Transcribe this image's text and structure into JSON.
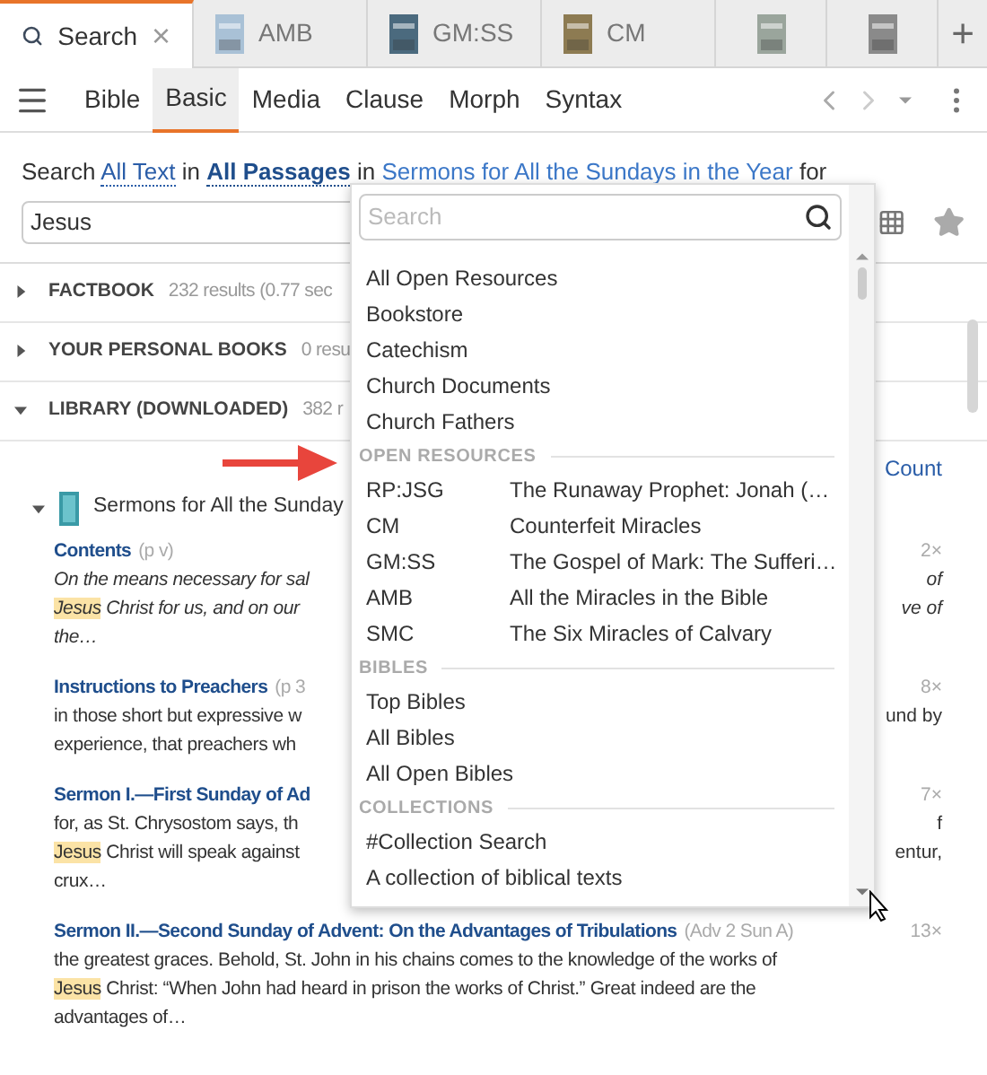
{
  "tabs": [
    {
      "kind": "search",
      "label": "Search",
      "selected": true,
      "close": "×"
    },
    {
      "kind": "book",
      "label": "AMB",
      "selected": false
    },
    {
      "kind": "book",
      "label": "GM:SS",
      "selected": false
    },
    {
      "kind": "book",
      "label": "CM",
      "selected": false
    },
    {
      "kind": "book",
      "selected": false
    },
    {
      "kind": "book",
      "selected": false
    }
  ],
  "new_tab": "+",
  "search_types": [
    {
      "label": "Bible",
      "selected": false
    },
    {
      "label": "Basic",
      "selected": true
    },
    {
      "label": "Media",
      "selected": false
    },
    {
      "label": "Clause",
      "selected": false
    },
    {
      "label": "Morph",
      "selected": false
    },
    {
      "label": "Syntax",
      "selected": false
    }
  ],
  "query_sentence": [
    {
      "kind": "plain",
      "text": "Search"
    },
    {
      "kind": "link",
      "text": "All Text"
    },
    {
      "kind": "plain",
      "text": "in"
    },
    {
      "kind": "strong_link",
      "text": "All Passages"
    },
    {
      "kind": "plain",
      "text": "in"
    },
    {
      "kind": "link",
      "text": "Sermons for All the Sundays in the Year"
    },
    {
      "kind": "plain",
      "text": "for"
    }
  ],
  "query": {
    "value": "Jesus"
  },
  "sections": [
    {
      "title": "FACTBOOK",
      "summary": "232 results (0.77 sec",
      "expanded": false
    },
    {
      "title": "YOUR PERSONAL BOOKS",
      "summary": "0 resu",
      "expanded": false
    },
    {
      "title": "LIBRARY (DOWNLOADED)",
      "summary": "382 r",
      "expanded": true
    }
  ],
  "count_link": "Count",
  "resource": {
    "title": "Sermons for All the Sunday",
    "expanded": true
  },
  "results": [
    {
      "title": "Contents",
      "ref": "(p v)",
      "hits": "2×",
      "italic": true,
      "lines": [
        {
          "left": "On the means necessary for sal",
          "right": "of"
        },
        {
          "highlight": "Jesus",
          "left": " Christ for us, and on our",
          "right": "ve of"
        },
        {
          "left": "the…"
        }
      ]
    },
    {
      "title": "Instructions to Preachers",
      "ref": "(p 3",
      "hits": "8×",
      "italic": false,
      "lines": [
        {
          "left": "in those short but expressive w",
          "right": "und by"
        },
        {
          "left": "experience, that preachers wh"
        }
      ]
    },
    {
      "title": "Sermon I.—First Sunday of Ad",
      "hits": "7×",
      "italic": false,
      "lines": [
        {
          "left": "for, as St. Chrysostom says, th",
          "right": "f"
        },
        {
          "highlight": "Jesus",
          "left": " Christ will speak against",
          "right": "entur,"
        },
        {
          "left": "crux…"
        }
      ]
    },
    {
      "title": "Sermon II.—Second Sunday of Advent: On the Advantages of Tribulations",
      "ref": "(Adv 2 Sun A)",
      "hits": "13×",
      "italic": false,
      "lines": [
        {
          "left": "the greatest graces. Behold, St. John in his chains comes to the knowledge of the works of"
        },
        {
          "highlight": "Jesus",
          "left": " Christ: “When John had heard in prison the works of Christ.” Great indeed are the"
        },
        {
          "left": "advantages of…"
        }
      ]
    }
  ],
  "dropdown": {
    "placeholder": "Search",
    "groups": [
      {
        "items": [
          {
            "label": "All Open Resources"
          },
          {
            "label": "Bookstore"
          },
          {
            "label": "Catechism"
          },
          {
            "label": "Church Documents"
          },
          {
            "label": "Church Fathers"
          }
        ]
      },
      {
        "header": "OPEN RESOURCES",
        "items": [
          {
            "abbrev": "RP:JSG",
            "label": "The Runaway Prophet: Jonah (…"
          },
          {
            "abbrev": "CM",
            "label": "Counterfeit Miracles"
          },
          {
            "abbrev": "GM:SS",
            "label": "The Gospel of Mark: The Sufferi…"
          },
          {
            "abbrev": "AMB",
            "label": "All the Miracles in the Bible"
          },
          {
            "abbrev": "SMC",
            "label": "The Six Miracles of Calvary"
          }
        ]
      },
      {
        "header": "BIBLES",
        "items": [
          {
            "label": "Top Bibles"
          },
          {
            "label": "All Bibles"
          },
          {
            "label": "All Open Bibles"
          }
        ]
      },
      {
        "header": "COLLECTIONS",
        "items": [
          {
            "label": "#Collection Search"
          },
          {
            "label": "A collection of biblical texts"
          }
        ]
      }
    ]
  }
}
